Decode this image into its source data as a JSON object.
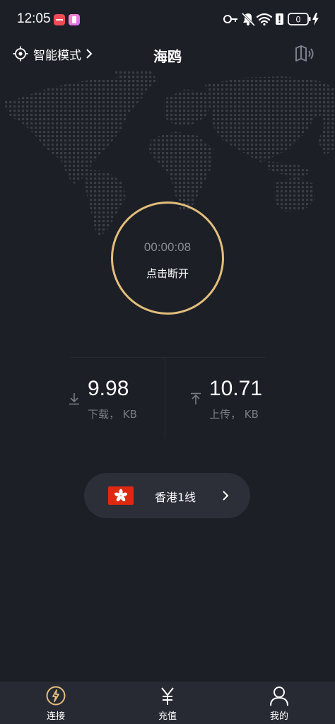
{
  "status_bar": {
    "time": "12:05",
    "battery": "0",
    "icons": [
      "key-icon",
      "bell-muted-icon",
      "wifi-icon",
      "sim-icon",
      "battery-icon",
      "charging-icon"
    ]
  },
  "header": {
    "mode_label": "智能模式",
    "title": "海鸥"
  },
  "connection": {
    "timer": "00:00:08",
    "action_label": "点击断开",
    "ring_color": "#e2be7b"
  },
  "stats": {
    "download": {
      "value": "9.98",
      "label": "下载， KB"
    },
    "upload": {
      "value": "10.71",
      "label": "上传， KB"
    }
  },
  "server": {
    "name": "香港1线",
    "flag": "hong-kong-flag-icon"
  },
  "bottom_nav": {
    "items": [
      {
        "label": "连接",
        "icon": "connect-icon",
        "active": true
      },
      {
        "label": "充值",
        "icon": "yuan-icon",
        "active": false
      },
      {
        "label": "我的",
        "icon": "profile-icon",
        "active": false
      }
    ]
  },
  "colors": {
    "background": "#1d1f27",
    "accent": "#e2be7b",
    "panel": "#2c2e38",
    "nav": "#282a33"
  }
}
